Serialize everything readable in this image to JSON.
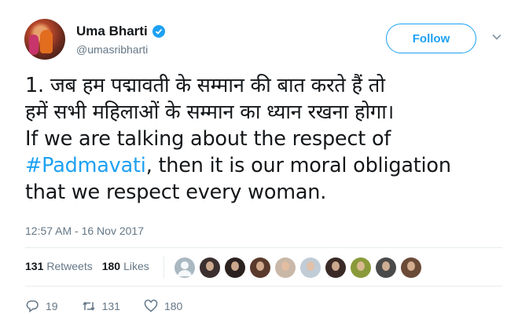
{
  "user": {
    "display_name": "Uma Bharti",
    "handle": "@umasribharti",
    "verified": true
  },
  "follow_label": "Follow",
  "tweet": {
    "line1": "1. जब हम पद्मावती के सम्मान की बात करते हैं तो",
    "line2": "हमें सभी महिलाओं के सम्मान का ध्यान रखना होगा।",
    "line3": "If we are talking about the respect of",
    "hashtag": "#Padmavati",
    "line4_rest": ", then it is our moral obligation",
    "line5": "that we respect every woman."
  },
  "timestamp": "12:57 AM - 16 Nov 2017",
  "stats": {
    "retweets_count": "131",
    "retweets_label": "Retweets",
    "likes_count": "180",
    "likes_label": "Likes"
  },
  "liker_avatars": [
    {
      "name": "default",
      "color": "#aab8c2"
    },
    {
      "name": "user2",
      "color": "#3b2f2f"
    },
    {
      "name": "user3",
      "color": "#2b2220"
    },
    {
      "name": "user4",
      "color": "#5a3a2c"
    },
    {
      "name": "user5",
      "color": "#c9b7a8"
    },
    {
      "name": "user6",
      "color": "#c0ccd6"
    },
    {
      "name": "user7",
      "color": "#3a2a26"
    },
    {
      "name": "user8",
      "color": "#8a9a3a"
    },
    {
      "name": "user9",
      "color": "#4a4a4a"
    },
    {
      "name": "user10",
      "color": "#6b4a38"
    }
  ],
  "actions": {
    "reply_count": "19",
    "retweet_count": "131",
    "like_count": "180"
  },
  "colors": {
    "accent": "#1da1f2",
    "text": "#14171a",
    "muted": "#657786"
  }
}
